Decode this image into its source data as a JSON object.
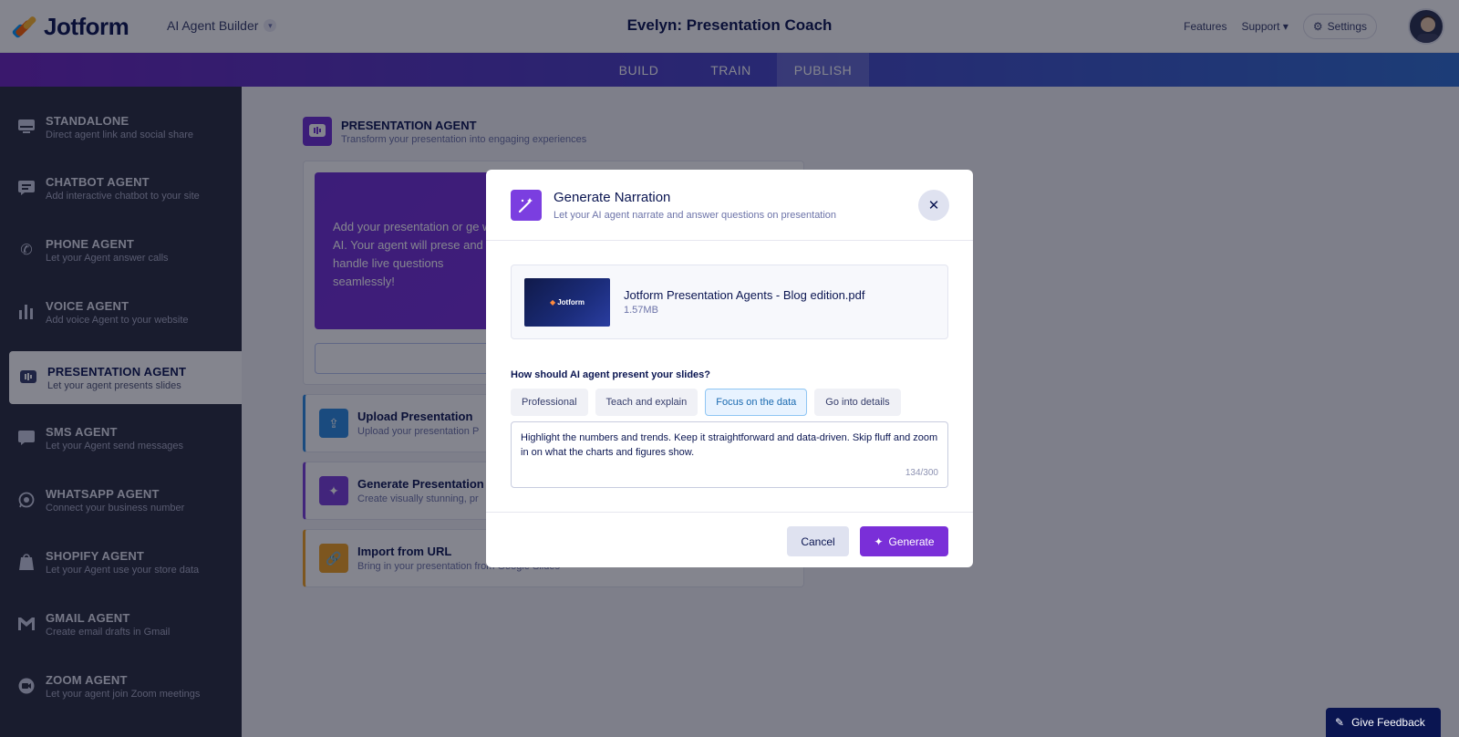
{
  "header": {
    "logo": "Jotform",
    "builder_label": "AI Agent Builder",
    "agent_title": "Evelyn: Presentation Coach",
    "features": "Features",
    "support": "Support",
    "settings": "Settings"
  },
  "tabs": [
    "BUILD",
    "TRAIN",
    "PUBLISH"
  ],
  "active_tab": "PUBLISH",
  "sidebar": {
    "items": [
      {
        "title": "STANDALONE",
        "subtitle": "Direct agent link and social share",
        "icon": "monitor-icon"
      },
      {
        "title": "CHATBOT AGENT",
        "subtitle": "Add interactive chatbot to your site",
        "icon": "chat-icon"
      },
      {
        "title": "PHONE AGENT",
        "subtitle": "Let your Agent answer calls",
        "icon": "phone-icon"
      },
      {
        "title": "VOICE AGENT",
        "subtitle": "Add voice Agent to your website",
        "icon": "voice-bars-icon"
      },
      {
        "title": "PRESENTATION AGENT",
        "subtitle": "Let your agent presents slides",
        "icon": "presentation-icon"
      },
      {
        "title": "SMS AGENT",
        "subtitle": "Let your Agent send messages",
        "icon": "sms-icon"
      },
      {
        "title": "WHATSAPP AGENT",
        "subtitle": "Connect your business number",
        "icon": "whatsapp-icon"
      },
      {
        "title": "SHOPIFY AGENT",
        "subtitle": "Let your Agent use your store data",
        "icon": "shopify-icon"
      },
      {
        "title": "GMAIL AGENT",
        "subtitle": "Create email drafts in Gmail",
        "icon": "gmail-icon"
      },
      {
        "title": "ZOOM AGENT",
        "subtitle": "Let your agent join Zoom meetings",
        "icon": "zoom-icon"
      }
    ]
  },
  "main": {
    "title": "PRESENTATION AGENT",
    "subtitle": "Transform your presentation into engaging experiences",
    "promo_text": "Add your presentation or ge with AI. Your agent will prese and handle live questions seamlessly!",
    "options": [
      {
        "title": "Upload Presentation",
        "subtitle": "Upload your presentation P",
        "color": "#2a8ae0"
      },
      {
        "title": "Generate Presentation w",
        "subtitle": "Create visually stunning, pr",
        "color": "#7a3edb"
      },
      {
        "title": "Import from URL",
        "subtitle": "Bring in your presentation from Google Slides",
        "color": "#f0a020"
      }
    ]
  },
  "modal": {
    "title": "Generate Narration",
    "subtitle": "Let your AI agent narrate and answer questions on presentation",
    "file_name": "Jotform Presentation Agents - Blog edition.pdf",
    "file_size": "1.57MB",
    "thumb_logo": "Jotform",
    "question": "How should AI agent present your slides?",
    "styles": [
      "Professional",
      "Teach and explain",
      "Focus on the data",
      "Go into details"
    ],
    "selected_style": "Focus on the data",
    "narration_text": "Highlight the numbers and trends. Keep it straightforward and data-driven. Skip fluff and zoom in on what the charts and figures show.",
    "char_count": "134/300",
    "cancel": "Cancel",
    "generate": "Generate"
  },
  "feedback": "Give Feedback",
  "colors": {
    "accent": "#7a2fd8",
    "sidebar_bg": "#292d3e",
    "navy": "#0a1551"
  }
}
